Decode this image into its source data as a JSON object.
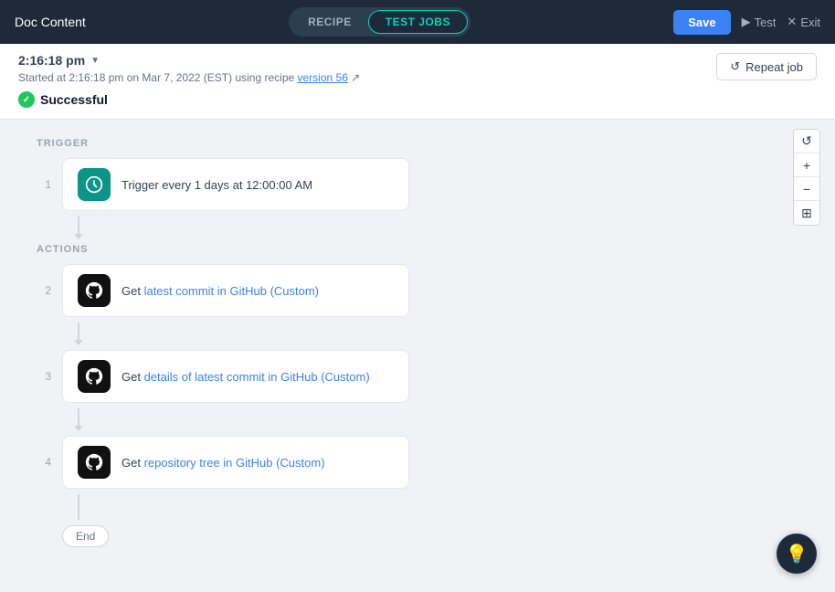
{
  "header": {
    "title": "Doc Content",
    "tab_recipe": "RECIPE",
    "tab_test_jobs": "TEST JOBS",
    "active_tab": "test_jobs",
    "save_label": "Save",
    "test_label": "Test",
    "exit_label": "Exit"
  },
  "job": {
    "time": "2:16:18 pm",
    "started_text": "Started at 2:16:18 pm on Mar 7, 2022 (EST) using recipe ",
    "version_label": "version 56",
    "status": "Successful",
    "repeat_label": "Repeat job"
  },
  "flow": {
    "trigger_section_label": "TRIGGER",
    "actions_section_label": "ACTIONS",
    "steps": [
      {
        "number": "1",
        "icon_type": "clock",
        "text": "Trigger every 1 days at 12:00:00 AM"
      },
      {
        "number": "2",
        "icon_type": "github",
        "text_prefix": "Get ",
        "text_link": "latest commit in GitHub (Custom)",
        "text": "Get latest commit in GitHub (Custom)"
      },
      {
        "number": "3",
        "icon_type": "github",
        "text_prefix": "Get ",
        "text_link": "details of latest commit in GitHub (Custom)",
        "text": "Get details of latest commit in GitHub (Custom)"
      },
      {
        "number": "4",
        "icon_type": "github",
        "text_prefix": "Get ",
        "text_link": "repository tree in GitHub (Custom)",
        "text": "Get repository tree in GitHub (Custom)"
      }
    ],
    "end_label": "End"
  },
  "zoom": {
    "reset_icon": "↺",
    "plus_icon": "+",
    "minus_icon": "−",
    "fit_icon": "⊞"
  }
}
